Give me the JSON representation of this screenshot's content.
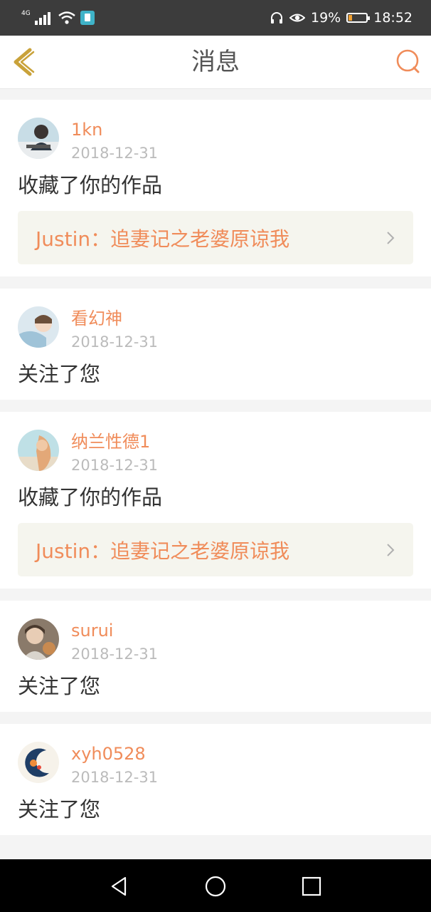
{
  "status_bar": {
    "network": "4G",
    "battery_percent": "19%",
    "battery_level": 0.19,
    "time": "18:52",
    "icons": [
      "signal-icon",
      "wifi-icon",
      "app-notification-icon",
      "headset-icon",
      "eye-comfort-icon",
      "battery-icon"
    ]
  },
  "header": {
    "title": "消息",
    "back_icon": "chevron-left-icon",
    "search_icon": "search-icon"
  },
  "colors": {
    "accent": "#f08c5a",
    "status_bar_bg": "#3c3c3c",
    "card_bg": "#ffffff",
    "page_bg": "#f4f4f4",
    "work_box_bg": "#f5f5ee"
  },
  "notifications": [
    {
      "user": "1kn",
      "date": "2018-12-31",
      "action": "收藏了你的作品",
      "work": "Justin：追妻记之老婆原谅我"
    },
    {
      "user": "看幻神",
      "date": "2018-12-31",
      "action": "关注了您"
    },
    {
      "user": "纳兰性德1",
      "date": "2018-12-31",
      "action": "收藏了你的作品",
      "work": "Justin：追妻记之老婆原谅我"
    },
    {
      "user": "surui",
      "date": "2018-12-31",
      "action": "关注了您"
    },
    {
      "user": "xyh0528",
      "date": "2018-12-31",
      "action": "关注了您"
    }
  ],
  "system_nav": [
    "back-icon",
    "home-icon",
    "recents-icon"
  ]
}
